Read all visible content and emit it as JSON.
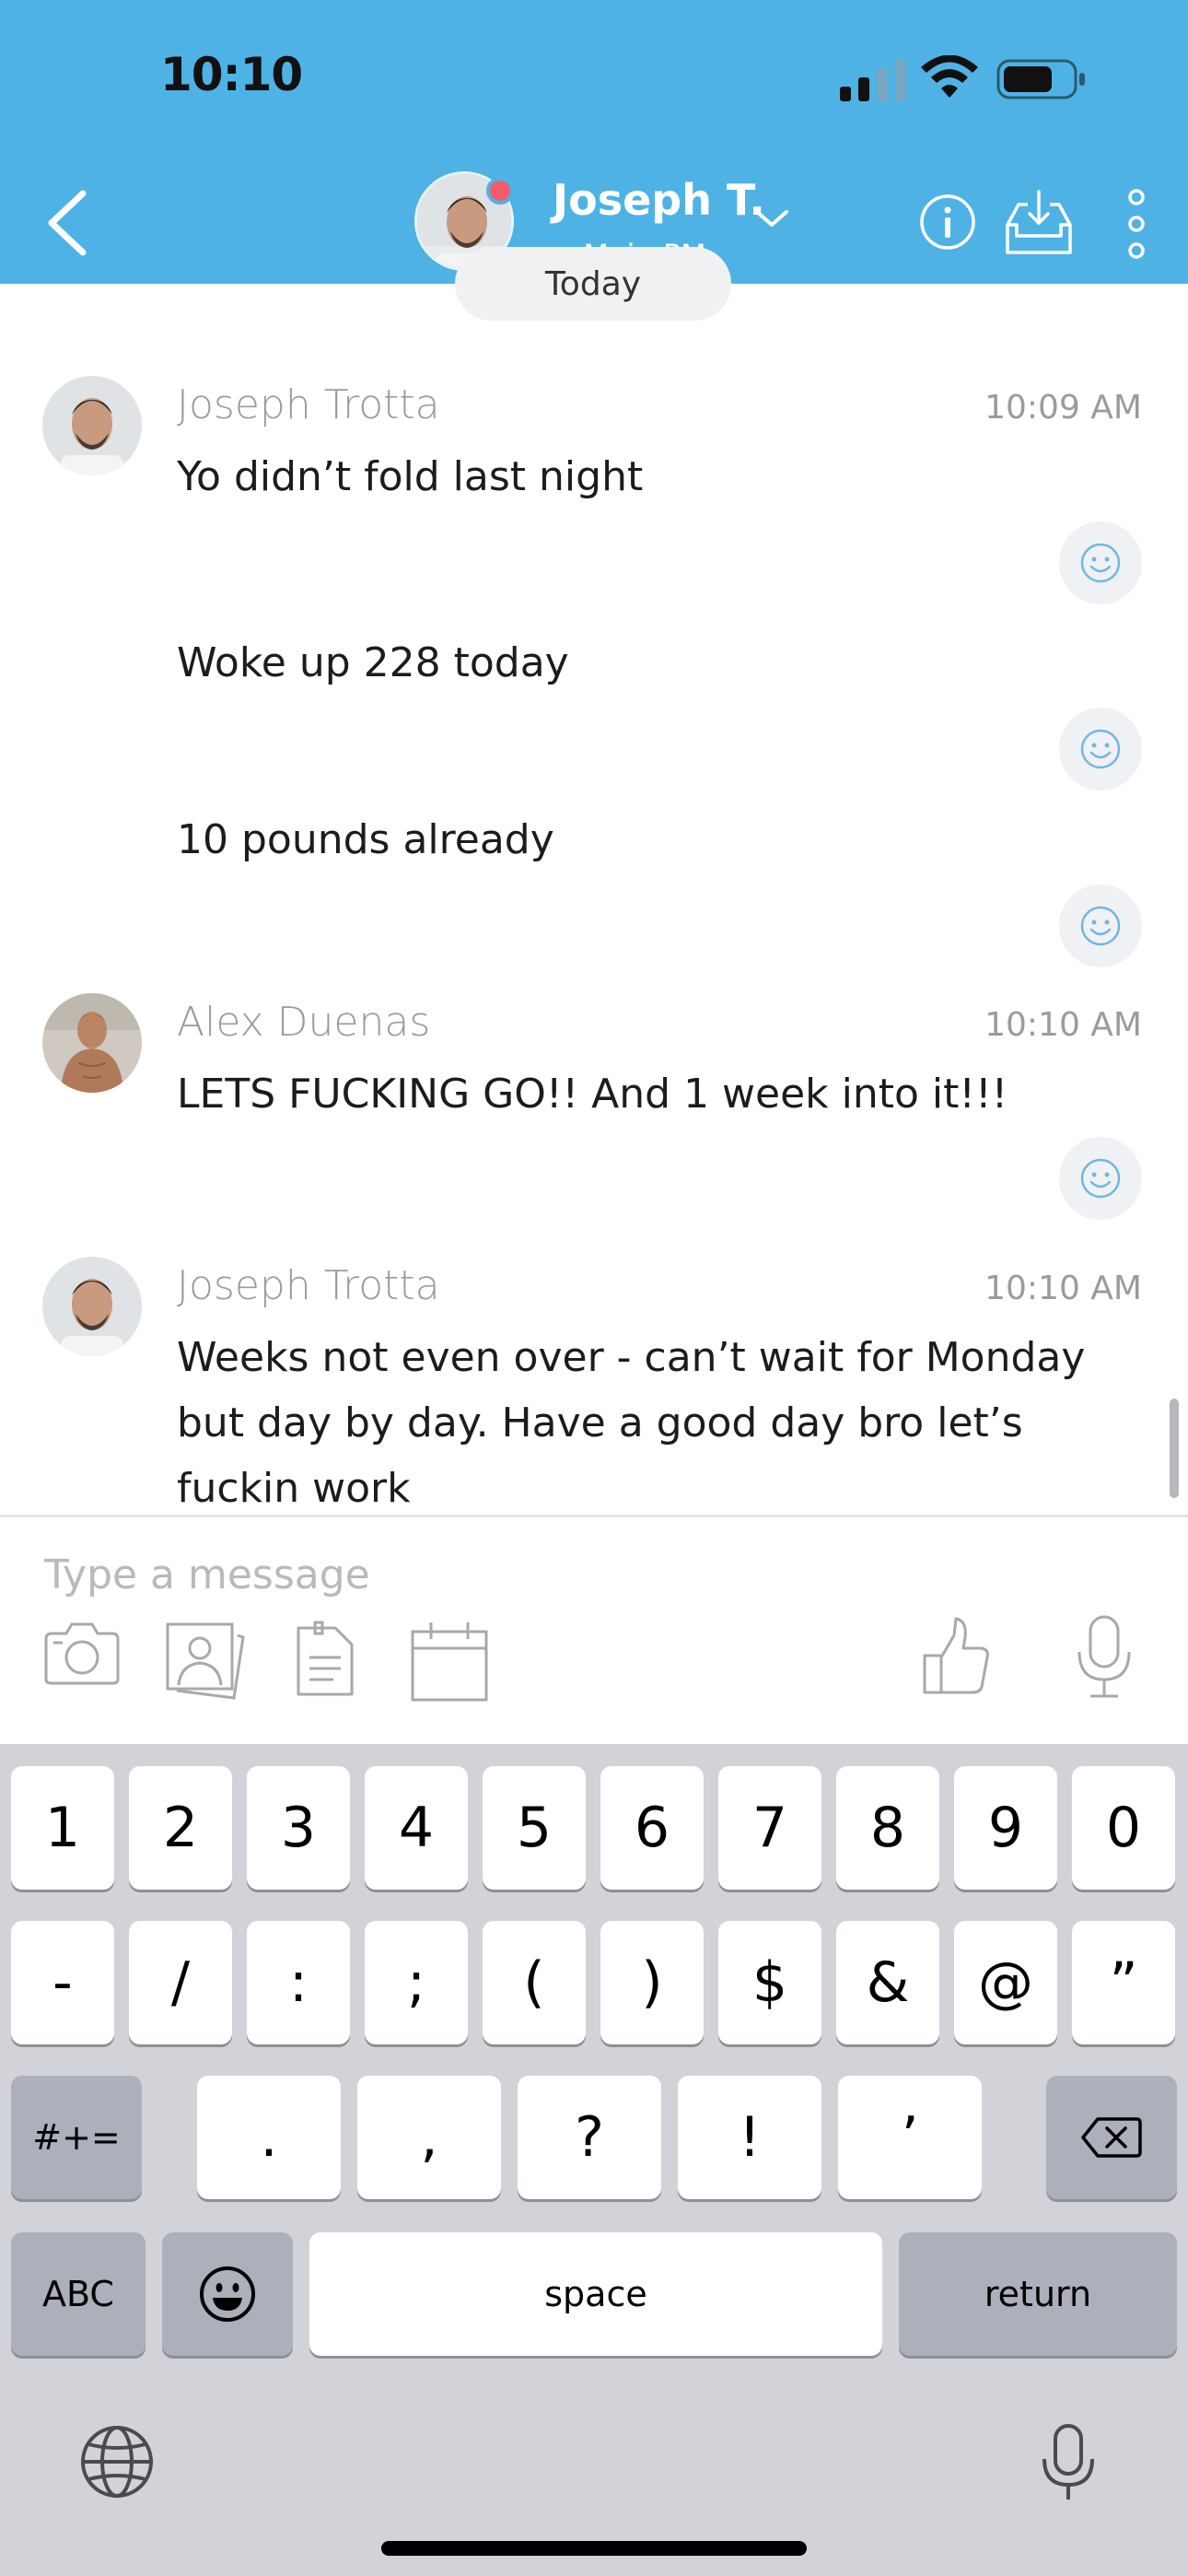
{
  "status_bar": {
    "time": "10:10"
  },
  "header": {
    "contact_name": "Joseph T.",
    "contact_subtitle": "Main PM",
    "background": "#4fb2e5",
    "online_color": "#f25c6a"
  },
  "conversation": {
    "date_label": "Today",
    "messages": [
      {
        "sender": "Joseph Trotta",
        "time": "10:09 AM",
        "text": "Yo didn’t fold last night"
      },
      {
        "sender": "",
        "time": "",
        "text": "Woke up 228 today"
      },
      {
        "sender": "",
        "time": "",
        "text": "10 pounds already"
      },
      {
        "sender": "Alex Duenas",
        "time": "10:10 AM",
        "text": "LETS FUCKING GO!! And 1 week into it!!!"
      },
      {
        "sender": "Joseph Trotta",
        "time": "10:10 AM",
        "text": "Weeks not even over - can’t wait for Monday but day by day. Have a good day bro let’s fuckin work"
      }
    ]
  },
  "composer": {
    "placeholder": "Type a message",
    "tools": [
      "camera-icon",
      "photo-icon",
      "document-icon",
      "calendar-icon",
      "thumbs-up-icon",
      "microphone-icon"
    ]
  },
  "keyboard": {
    "row1": [
      "1",
      "2",
      "3",
      "4",
      "5",
      "6",
      "7",
      "8",
      "9",
      "0"
    ],
    "row2": [
      "-",
      "/",
      ":",
      ";",
      "(",
      ")",
      "$",
      "&",
      "@",
      "”"
    ],
    "row3": [
      ".",
      ",",
      "?",
      "!",
      "’"
    ],
    "symbols_toggle": "#+=",
    "abc_toggle": "ABC",
    "space": "space",
    "return": "return"
  }
}
